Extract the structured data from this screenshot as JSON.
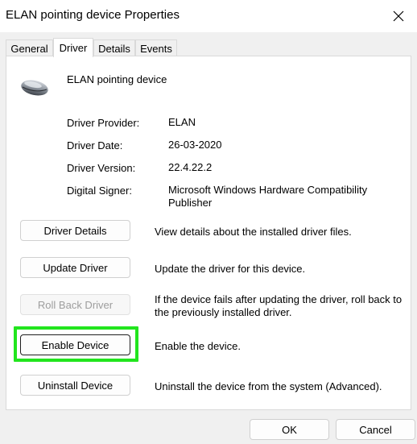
{
  "window": {
    "title": "ELAN pointing device Properties"
  },
  "tabs": [
    {
      "label": "General"
    },
    {
      "label": "Driver"
    },
    {
      "label": "Details"
    },
    {
      "label": "Events"
    }
  ],
  "device": {
    "name": "ELAN pointing device",
    "icon": "mouse-icon"
  },
  "properties": [
    {
      "label": "Driver Provider:",
      "value": "ELAN"
    },
    {
      "label": "Driver Date:",
      "value": "26-03-2020"
    },
    {
      "label": "Driver Version:",
      "value": "22.4.22.2"
    },
    {
      "label": "Digital Signer:",
      "value": "Microsoft Windows Hardware Compatibility Publisher"
    }
  ],
  "actions": [
    {
      "button": "Driver Details",
      "description": "View details about the installed driver files.",
      "enabled": true
    },
    {
      "button": "Update Driver",
      "description": "Update the driver for this device.",
      "enabled": true
    },
    {
      "button": "Roll Back Driver",
      "description": "If the device fails after updating the driver, roll back to the previously installed driver.",
      "enabled": false
    },
    {
      "button": "Enable Device",
      "description": "Enable the device.",
      "enabled": true,
      "highlighted": true
    },
    {
      "button": "Uninstall Device",
      "description": "Uninstall the device from the system (Advanced).",
      "enabled": true
    }
  ],
  "footer": {
    "ok_label": "OK",
    "cancel_label": "Cancel"
  },
  "colors": {
    "highlight": "#22e51e",
    "panel_bg": "#ffffff",
    "window_bg": "#f0f0f0"
  }
}
